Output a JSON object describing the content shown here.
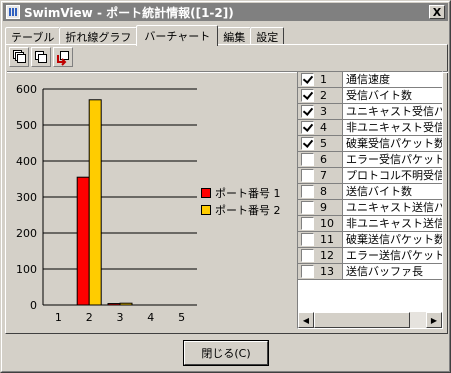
{
  "window": {
    "title": "SwimView - ポート統計情報([1-2])",
    "close_label": "X"
  },
  "tabs": [
    {
      "label": "テーブル",
      "active": false
    },
    {
      "label": "折れ線グラフ",
      "active": false
    },
    {
      "label": "バーチャート",
      "active": true
    },
    {
      "label": "編集",
      "active": false
    },
    {
      "label": "設定",
      "active": false
    }
  ],
  "toolbar": {
    "icons": [
      "copy-stack-icon",
      "copy-pages-icon",
      "export-icon"
    ]
  },
  "chart_data": {
    "type": "bar",
    "categories": [
      "1",
      "2",
      "3",
      "4",
      "5"
    ],
    "series": [
      {
        "name": "ポート番号 1",
        "color": "#ff0000",
        "values": [
          0,
          355,
          4,
          0,
          0
        ]
      },
      {
        "name": "ポート番号 2",
        "color": "#ffcc00",
        "values": [
          0,
          570,
          5,
          0,
          0
        ]
      }
    ],
    "yticks": [
      "0",
      "100",
      "200",
      "300",
      "400",
      "500",
      "600"
    ],
    "ylim": [
      0,
      600
    ],
    "grid": true,
    "legend_position": "right"
  },
  "counters": [
    {
      "num": "1",
      "name": "通信速度",
      "checked": true
    },
    {
      "num": "2",
      "name": "受信バイト数",
      "checked": true
    },
    {
      "num": "3",
      "name": "ユニキャスト受信パケット数",
      "checked": true
    },
    {
      "num": "4",
      "name": "非ユニキャスト受信パケット数",
      "checked": true
    },
    {
      "num": "5",
      "name": "破棄受信パケット数",
      "checked": true
    },
    {
      "num": "6",
      "name": "エラー受信パケット数",
      "checked": false
    },
    {
      "num": "7",
      "name": "プロトコル不明受信パケット数",
      "checked": false
    },
    {
      "num": "8",
      "name": "送信バイト数",
      "checked": false
    },
    {
      "num": "9",
      "name": "ユニキャスト送信パケット数",
      "checked": false
    },
    {
      "num": "10",
      "name": "非ユニキャスト送信パケット数",
      "checked": false
    },
    {
      "num": "11",
      "name": "破棄送信パケット数",
      "checked": false
    },
    {
      "num": "12",
      "name": "エラー送信パケット数",
      "checked": false
    },
    {
      "num": "13",
      "name": "送信バッファ長",
      "checked": false
    }
  ],
  "footer": {
    "close_button": "閉じる(C)"
  }
}
